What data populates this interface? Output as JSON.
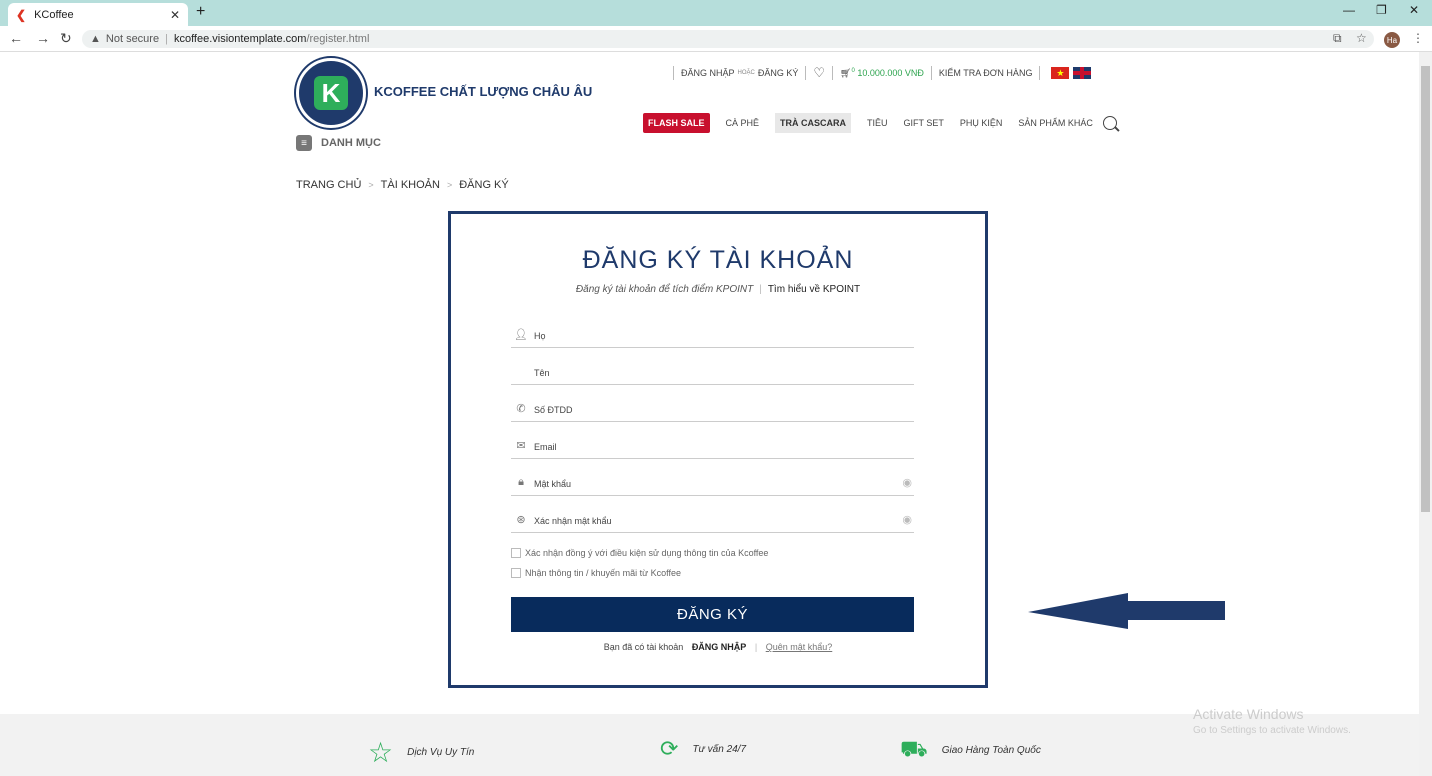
{
  "browser": {
    "tab_title": "KCoffee",
    "url_warning": "Not secure",
    "url_host": "kcoffee.visiontemplate.com",
    "url_path": "/register.html",
    "profile_initials": "Ha"
  },
  "header": {
    "brand": "KCOFFEE CHẤT LƯỢNG CHÂU ÂU",
    "menu_label": "DANH MỤC",
    "login": "ĐĂNG NHẬP",
    "or": "HOẶC",
    "register": "ĐĂNG KÝ",
    "cart_total": "10.000.000 VNĐ",
    "cart_count": "0",
    "order_check": "KIỂM TRA ĐƠN HÀNG",
    "nav": [
      "FLASH SALE",
      "CÀ PHÊ",
      "TRÀ CASCARA",
      "TIÊU",
      "GIFT SET",
      "PHỤ KIỆN",
      "SẢN PHẨM KHÁC"
    ]
  },
  "breadcrumb": [
    "TRANG CHỦ",
    "TÀI KHOẢN",
    "ĐĂNG KÝ"
  ],
  "form": {
    "title": "ĐĂNG KÝ TÀI KHOẢN",
    "subtitle_note": "Đăng ký tài khoản để tích điểm KPOINT",
    "subtitle_link": "Tìm hiểu về KPOINT",
    "fields": {
      "last_name": "Họ",
      "first_name": "Tên",
      "phone": "Số ĐTDD",
      "email": "Email",
      "password": "Mật khẩu",
      "password_confirm": "Xác nhận mật khẩu"
    },
    "checks": {
      "terms": "Xác nhận đồng ý với điều kiện sử dụng thông tin của Kcoffee",
      "newsletter": "Nhận thông tin / khuyến mãi từ Kcoffee"
    },
    "submit": "ĐĂNG KÝ",
    "footer_text": "Bạn đã có tài khoản",
    "footer_login": "ĐĂNG NHẬP",
    "footer_forgot": "Quên mật khẩu?"
  },
  "features": [
    "Dịch Vụ Uy Tín",
    "Tư vấn 24/7",
    "Giao Hàng Toàn Quốc"
  ],
  "watermark": {
    "line1": "Activate Windows",
    "line2": "Go to Settings to activate Windows."
  },
  "colors": {
    "navy": "#1f3a6b",
    "button": "#082b5c",
    "flash": "#c8102e",
    "green": "#2eae5b"
  }
}
